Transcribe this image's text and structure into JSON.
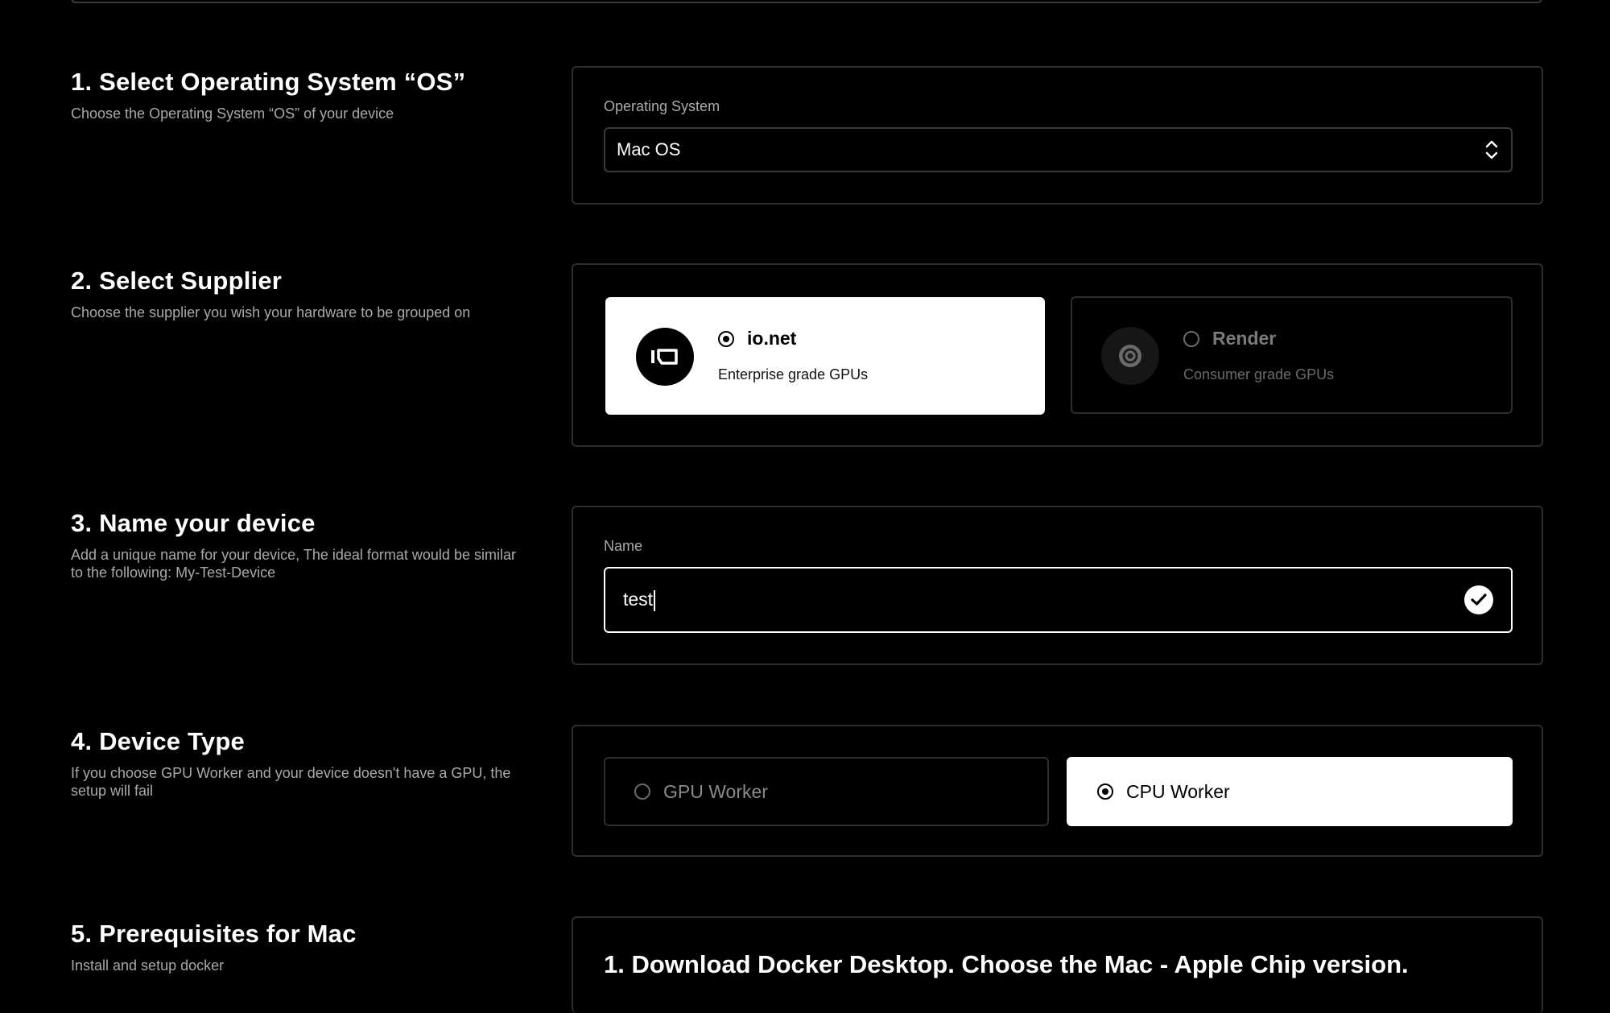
{
  "sections": {
    "os": {
      "title": "1. Select Operating System “OS”",
      "desc": "Choose the Operating System “OS” of your device",
      "field_label": "Operating System",
      "selected": "Mac OS"
    },
    "supplier": {
      "title": "2. Select Supplier",
      "desc": "Choose the supplier you wish your hardware to be grouped on",
      "options": [
        {
          "name": "io.net",
          "sub": "Enterprise grade GPUs",
          "selected": true
        },
        {
          "name": "Render",
          "sub": "Consumer grade GPUs",
          "selected": false
        }
      ]
    },
    "name": {
      "title": "3. Name your device",
      "desc": "Add a unique name for your device, The ideal format would be similar to the following: My-Test-Device",
      "field_label": "Name",
      "value": "test"
    },
    "device_type": {
      "title": "4. Device Type",
      "desc": "If you choose GPU Worker and your device doesn't have a GPU, the setup will fail",
      "options": [
        {
          "label": "GPU Worker",
          "selected": false
        },
        {
          "label": "CPU Worker",
          "selected": true
        }
      ]
    },
    "prereq": {
      "title": "5. Prerequisites for Mac",
      "desc": "Install and setup docker",
      "step1": "1. Download Docker Desktop. Choose the Mac - Apple Chip version."
    }
  },
  "icons": [
    "chevron-updown-icon",
    "io-net-logo-icon",
    "render-logo-icon",
    "check-icon"
  ],
  "colors": {
    "background": "#000000",
    "panel_border": "#2e2e2e",
    "selected": "#ffffff",
    "muted": "#a9a9a9"
  }
}
